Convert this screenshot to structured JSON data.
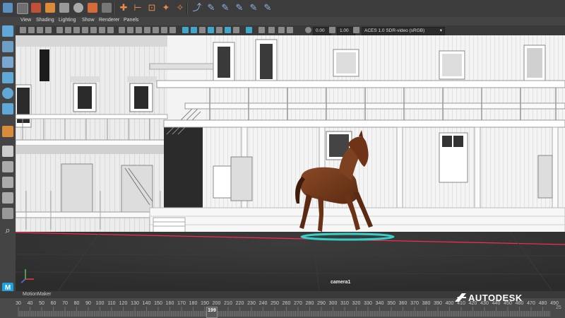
{
  "app": {
    "panel_menu": [
      "View",
      "Shading",
      "Lighting",
      "Show",
      "Renderer",
      "Panels"
    ],
    "exposure_value": "0.00",
    "gamma_value": "1.00",
    "color_space": "ACES 1.0 SDR-video (sRGB)"
  },
  "viewport": {
    "camera_label": "camera1"
  },
  "status": {
    "label": "MotionMaker"
  },
  "timeline": {
    "ticks": [
      "30",
      "40",
      "50",
      "60",
      "70",
      "80",
      "90",
      "100",
      "110",
      "120",
      "130",
      "140",
      "150",
      "160",
      "170",
      "180",
      "190",
      "200",
      "210",
      "220",
      "230",
      "240",
      "250",
      "260",
      "270",
      "280",
      "290",
      "300",
      "310",
      "320",
      "330",
      "340",
      "350",
      "360",
      "370",
      "380",
      "390",
      "400",
      "410",
      "420",
      "430",
      "440",
      "450",
      "460",
      "470",
      "480",
      "490"
    ],
    "current_frame": "199",
    "end_frame": "25"
  },
  "brand": {
    "name": "AUTODESK"
  },
  "colors": {
    "accent": "#3fa7c9",
    "horse": "#7a3a1c",
    "ground_line": "#ff2a55",
    "motion_ring": "#35d0c8"
  }
}
